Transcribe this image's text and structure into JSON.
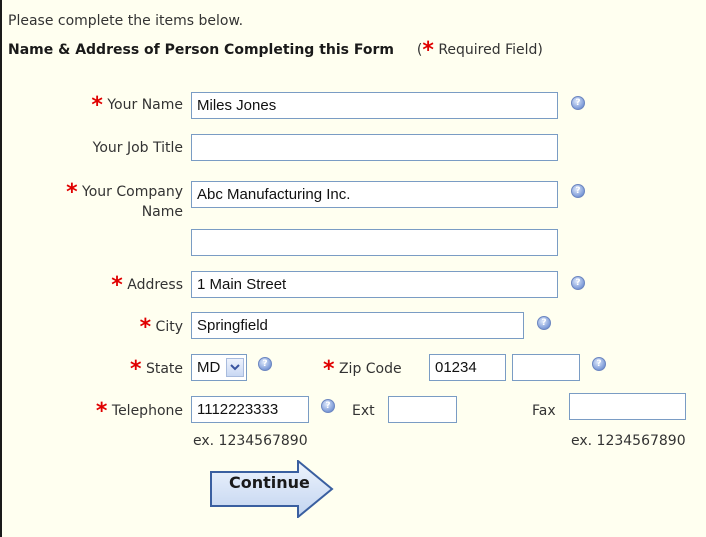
{
  "intro": "Please complete the items below.",
  "section_title": "Name & Address of Person Completing this Form",
  "required_note": {
    "open": "(",
    "star": "*",
    "text": " Required Field)"
  },
  "required_marker": "*",
  "help_icon_glyph": "?",
  "fields": {
    "name": {
      "label": "Your Name",
      "value": "Miles Jones"
    },
    "job_title": {
      "label": "Your Job Title",
      "value": ""
    },
    "company": {
      "label_line1": "Your Company",
      "label_line2": "Name",
      "value": "Abc Manufacturing Inc.",
      "value2": ""
    },
    "address": {
      "label": "Address",
      "value": "1 Main Street"
    },
    "city": {
      "label": "City",
      "value": "Springfield"
    },
    "state": {
      "label": "State",
      "value": "MD"
    },
    "zip": {
      "label": "Zip Code",
      "value": "01234",
      "value_ext": ""
    },
    "telephone": {
      "label": "Telephone",
      "value": "1112223333",
      "hint": "ex. 1234567890"
    },
    "ext": {
      "label": "Ext",
      "value": ""
    },
    "fax": {
      "label": "Fax",
      "value": "",
      "hint": "ex. 1234567890"
    }
  },
  "continue_button": "Continue",
  "colors": {
    "panel_bg": "#fffff0",
    "required_star": "#e00000",
    "input_border": "#7a9cc4",
    "button_fill": "#dbe6f7",
    "button_stroke": "#3a5fa0"
  },
  "icons": {
    "help": "help-icon",
    "select_arrow": "chevron-down-icon",
    "continue_arrow": "arrow-right-icon"
  }
}
